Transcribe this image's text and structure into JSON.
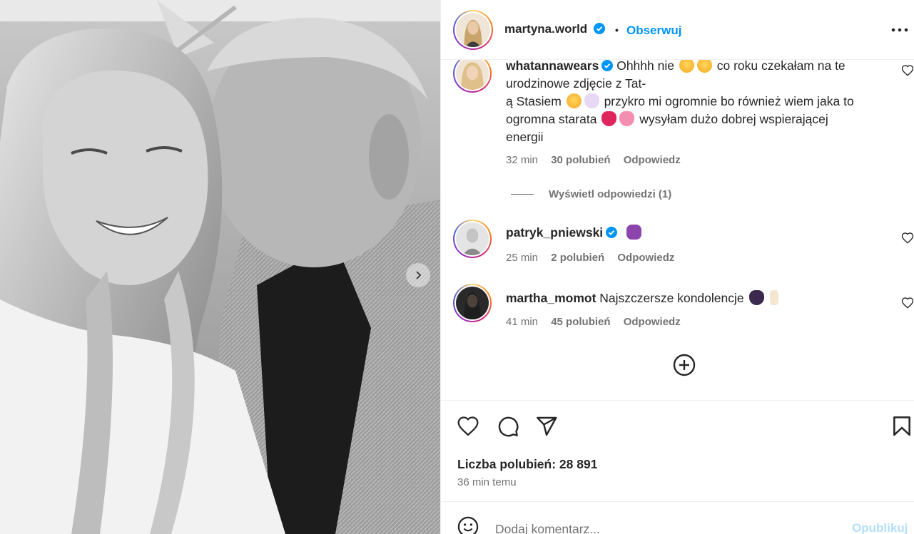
{
  "header": {
    "username": "martyna.world",
    "separator": "•",
    "follow_label": "Obserwuj",
    "more_icon": "more-horizontal-icon"
  },
  "comments": [
    {
      "username": "whatannawears",
      "verified": true,
      "lines": [
        "Ohhhh nie",
        "co roku czekałam na te",
        "urodzinowe zdjęcie z Tat-",
        "ą Stasiem",
        "przykro mi ogromnie bo również wiem jaka to",
        "ogromna starata",
        "wysyłam dużo dobrej wspierającej",
        "energii"
      ],
      "time": "32 min",
      "likes": "30 polubień",
      "reply": "Odpowiedz",
      "view_replies": "Wyświetl odpowiedzi (1)"
    },
    {
      "username": "patryk_pniewski",
      "verified": true,
      "text": "",
      "time": "25 min",
      "likes": "2 polubień",
      "reply": "Odpowiedz"
    },
    {
      "username": "martha_momot",
      "verified": false,
      "text": "Najszczersze kondolencje",
      "time": "41 min",
      "likes": "45 polubień",
      "reply": "Odpowiedz"
    }
  ],
  "actions": {
    "likes_label": "Liczba polubień: 28 891",
    "posted": "36 min temu"
  },
  "add_comment": {
    "placeholder": "Dodaj komentarz...",
    "publish_label": "Opublikuj"
  },
  "colors": {
    "accent": "#0095f6",
    "muted": "#737373",
    "text": "#262626",
    "publish_disabled": "#b2dffc"
  }
}
